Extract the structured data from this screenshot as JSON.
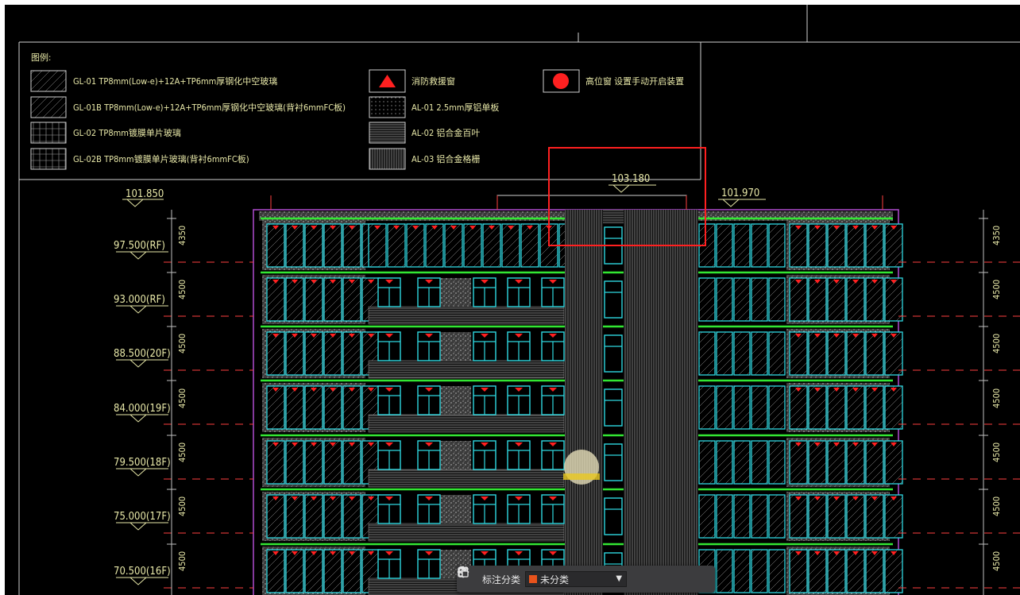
{
  "legend": {
    "title": "图例:",
    "items": [
      {
        "code": "GL-01",
        "text": "TP8mm(Low-e)+12A+TP6mm厚钢化中空玻璃"
      },
      {
        "code": "GL-01B",
        "text": "TP8mm(Low-e)+12A+TP6mm厚钢化中空玻璃(背衬6mmFC板)"
      },
      {
        "code": "GL-02",
        "text": "TP8mm镀膜单片玻璃"
      },
      {
        "code": "GL-02B",
        "text": "TP8mm镀膜单片玻璃(背衬6mmFC板)"
      },
      {
        "code": "",
        "text": "消防救援窗"
      },
      {
        "code": "AL-01",
        "text": "2.5mm厚铝单板"
      },
      {
        "code": "AL-02",
        "text": "铝合金百叶"
      },
      {
        "code": "AL-03",
        "text": "铝合金格栅"
      },
      {
        "code": "",
        "text": "高位窗 设置手动开启装置"
      }
    ]
  },
  "elevations": {
    "top_left": "101.850",
    "top_center": "103.180",
    "top_right": "101.970",
    "levels": [
      "97.500(RF)",
      "93.000(RF)",
      "88.500(20F)",
      "84.000(19F)",
      "79.500(18F)",
      "75.000(17F)",
      "70.500(16F)"
    ],
    "dims_left": [
      "4350",
      "4500",
      "4500",
      "4500",
      "4500",
      "4500",
      "4500"
    ],
    "dims_right": [
      "4350",
      "4500",
      "4500",
      "4500",
      "4500",
      "4500",
      "4500"
    ]
  },
  "toolbar": {
    "label": "标注分类",
    "category_value": "未分类",
    "category_color": "#e8531c"
  },
  "colors": {
    "window_frame": "#2fd8e0",
    "slab": "#33e633",
    "accent_red": "#ff2020",
    "text": "#e8e8a8",
    "selection_box": "#ff2020"
  }
}
